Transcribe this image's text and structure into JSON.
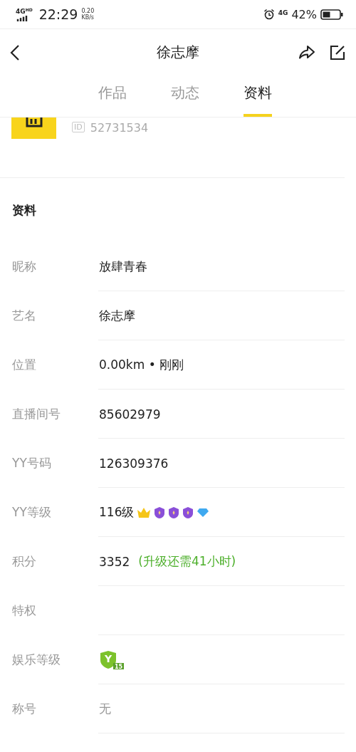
{
  "status_bar": {
    "network": "4G",
    "network_tag": "HD",
    "time": "22:29",
    "speed_value": "0.20",
    "speed_unit": "KB/s",
    "network_right": "4G",
    "battery": "42%"
  },
  "nav": {
    "title": "徐志摩"
  },
  "tabs": [
    {
      "label": "作品",
      "selected": false
    },
    {
      "label": "动态",
      "selected": false
    },
    {
      "label": "资料",
      "selected": true
    }
  ],
  "profile": {
    "id_tag": "ID",
    "id": "52731534"
  },
  "section_title": "资料",
  "rows": [
    {
      "kind": "text",
      "label": "昵称",
      "value": "放肆青春"
    },
    {
      "kind": "text",
      "label": "艺名",
      "value": "徐志摩"
    },
    {
      "kind": "text",
      "label": "位置",
      "value": "0.00km • 刚刚"
    },
    {
      "kind": "text",
      "label": "直播间号",
      "value": "85602979"
    },
    {
      "kind": "text",
      "label": "YY号码",
      "value": "126309376"
    },
    {
      "kind": "level",
      "label": "YY等级",
      "value": "116级"
    },
    {
      "kind": "points",
      "label": "积分",
      "value": "3352",
      "note": "(升级还需41小时)"
    },
    {
      "kind": "empty",
      "label": "特权"
    },
    {
      "kind": "badge",
      "label": "娱乐等级",
      "badge_letter": "Y",
      "badge_number": "15"
    },
    {
      "kind": "muted",
      "label": "称号",
      "value": "无"
    }
  ]
}
